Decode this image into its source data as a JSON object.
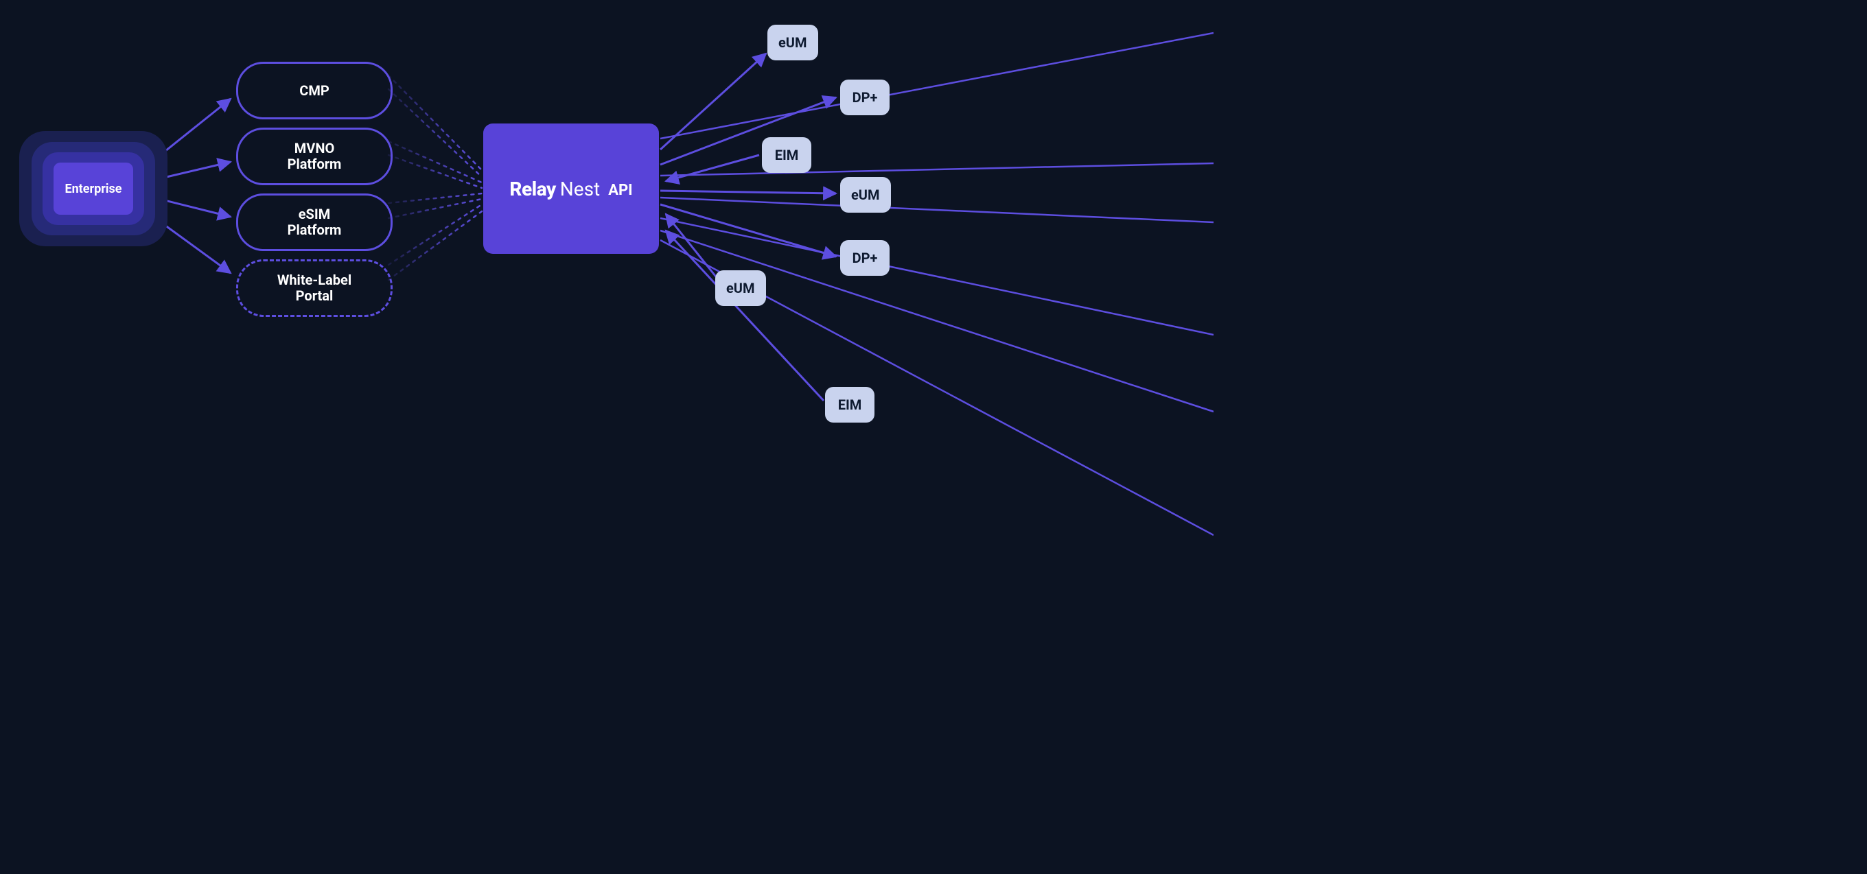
{
  "source": {
    "label": "Enterprise"
  },
  "platforms": {
    "cmp": "CMP",
    "mvno": "MVNO\nPlatform",
    "esim": "eSIM\nPlatform",
    "white_label": "White-Label\nPortal"
  },
  "center": {
    "brand_bold": "Relay",
    "brand_light": "Nest",
    "suffix": "API"
  },
  "outputs": {
    "n0": "eUM",
    "n1": "DP+",
    "n2": "EIM",
    "n3": "eUM",
    "n4": "DP+",
    "n5": "eUM",
    "n6": "EIM"
  },
  "colors": {
    "background": "#0c1322",
    "accent": "#5843d8",
    "line": "#5d4ee0",
    "node_fill": "#c9d3ee",
    "node_text": "#0e1a30"
  }
}
